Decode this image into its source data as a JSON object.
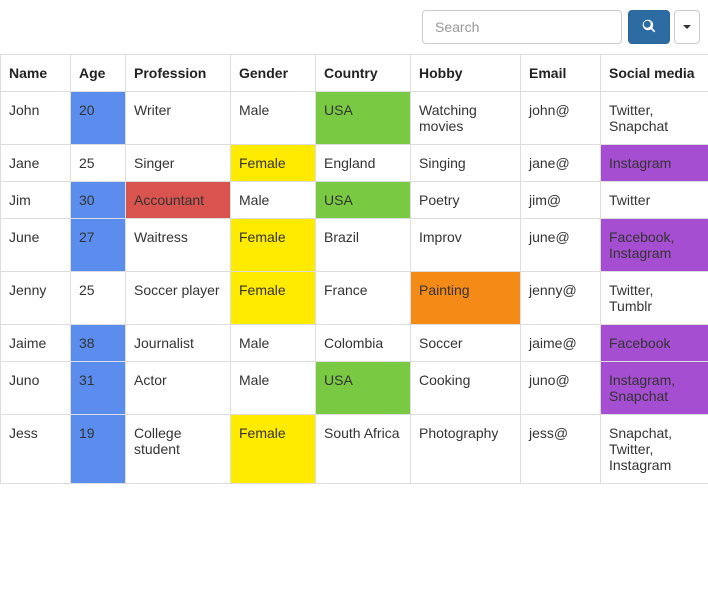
{
  "search": {
    "placeholder": "Search",
    "value": ""
  },
  "colors": {
    "blue": "#5b8def",
    "red": "#d9534f",
    "green": "#7ac943",
    "yellow": "#ffeb00",
    "purple": "#a64ed1",
    "orange": "#f58b17"
  },
  "columns": [
    {
      "key": "name",
      "label": "Name"
    },
    {
      "key": "age",
      "label": "Age"
    },
    {
      "key": "profession",
      "label": "Profession"
    },
    {
      "key": "gender",
      "label": "Gender"
    },
    {
      "key": "country",
      "label": "Country"
    },
    {
      "key": "hobby",
      "label": "Hobby"
    },
    {
      "key": "email",
      "label": "Email"
    },
    {
      "key": "social",
      "label": "Social media"
    }
  ],
  "rows": [
    {
      "name": {
        "value": "John"
      },
      "age": {
        "value": "20",
        "highlight": "blue"
      },
      "profession": {
        "value": "Writer"
      },
      "gender": {
        "value": "Male"
      },
      "country": {
        "value": "USA",
        "highlight": "green"
      },
      "hobby": {
        "value": "Watching movies"
      },
      "email": {
        "value": "john@"
      },
      "social": {
        "value": "Twitter, Snapchat"
      }
    },
    {
      "name": {
        "value": "Jane"
      },
      "age": {
        "value": "25"
      },
      "profession": {
        "value": "Singer"
      },
      "gender": {
        "value": "Female",
        "highlight": "yellow"
      },
      "country": {
        "value": "England"
      },
      "hobby": {
        "value": "Singing"
      },
      "email": {
        "value": "jane@"
      },
      "social": {
        "value": "Instagram",
        "highlight": "purple"
      }
    },
    {
      "name": {
        "value": "Jim"
      },
      "age": {
        "value": "30",
        "highlight": "blue"
      },
      "profession": {
        "value": "Accountant",
        "highlight": "red"
      },
      "gender": {
        "value": "Male"
      },
      "country": {
        "value": "USA",
        "highlight": "green"
      },
      "hobby": {
        "value": "Poetry"
      },
      "email": {
        "value": "jim@"
      },
      "social": {
        "value": "Twitter"
      }
    },
    {
      "name": {
        "value": "June"
      },
      "age": {
        "value": "27",
        "highlight": "blue"
      },
      "profession": {
        "value": "Waitress"
      },
      "gender": {
        "value": "Female",
        "highlight": "yellow"
      },
      "country": {
        "value": "Brazil"
      },
      "hobby": {
        "value": "Improv"
      },
      "email": {
        "value": "june@"
      },
      "social": {
        "value": "Facebook, Instagram",
        "highlight": "purple"
      }
    },
    {
      "name": {
        "value": "Jenny"
      },
      "age": {
        "value": "25"
      },
      "profession": {
        "value": "Soccer player"
      },
      "gender": {
        "value": "Female",
        "highlight": "yellow"
      },
      "country": {
        "value": "France"
      },
      "hobby": {
        "value": "Painting",
        "highlight": "orange"
      },
      "email": {
        "value": "jenny@"
      },
      "social": {
        "value": "Twitter, Tumblr"
      }
    },
    {
      "name": {
        "value": "Jaime"
      },
      "age": {
        "value": "38",
        "highlight": "blue"
      },
      "profession": {
        "value": "Journalist"
      },
      "gender": {
        "value": "Male"
      },
      "country": {
        "value": "Colombia"
      },
      "hobby": {
        "value": "Soccer"
      },
      "email": {
        "value": "jaime@"
      },
      "social": {
        "value": "Facebook",
        "highlight": "purple"
      }
    },
    {
      "name": {
        "value": "Juno"
      },
      "age": {
        "value": "31",
        "highlight": "blue"
      },
      "profession": {
        "value": "Actor"
      },
      "gender": {
        "value": "Male"
      },
      "country": {
        "value": "USA",
        "highlight": "green"
      },
      "hobby": {
        "value": "Cooking"
      },
      "email": {
        "value": "juno@"
      },
      "social": {
        "value": "Instagram, Snapchat",
        "highlight": "purple"
      }
    },
    {
      "name": {
        "value": "Jess"
      },
      "age": {
        "value": "19",
        "highlight": "blue"
      },
      "profession": {
        "value": "College student"
      },
      "gender": {
        "value": "Female",
        "highlight": "yellow"
      },
      "country": {
        "value": "South Africa"
      },
      "hobby": {
        "value": "Photography"
      },
      "email": {
        "value": "jess@"
      },
      "social": {
        "value": "Snapchat, Twitter, Instagram"
      }
    }
  ]
}
